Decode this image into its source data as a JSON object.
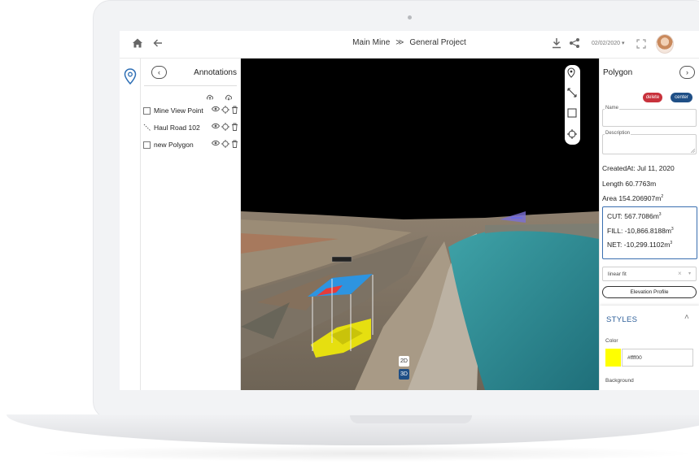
{
  "header": {
    "project": "Main Mine",
    "separator": "≫",
    "subproject": "General Project",
    "date": "02/02/2020",
    "date_caret": "▾",
    "icons": [
      "home-icon",
      "back-arrow-icon",
      "download-icon",
      "share-icon",
      "fullscreen-icon"
    ]
  },
  "annotations": {
    "title": "Annotations",
    "back_glyph": "‹",
    "items": [
      {
        "label": "Mine View Point",
        "type": "point"
      },
      {
        "label": "Haul Road 102",
        "type": "line"
      },
      {
        "label": "new Polygon",
        "type": "polygon"
      }
    ]
  },
  "viewport": {
    "mode_2d": "2D",
    "mode_3d": "3D",
    "active_mode": "3D",
    "tools": [
      "location-pin-icon",
      "measure-line-icon",
      "rectangle-icon",
      "crosshair-icon"
    ]
  },
  "details": {
    "title": "Polygon",
    "next_glyph": "›",
    "delete_label": "delete",
    "center_label": "center",
    "name_label": "Name",
    "name_value": "",
    "description_label": "Description",
    "description_value": "",
    "created_at": "CreatedAt: Jul 11, 2020",
    "length": "Length 60.7763m",
    "area": "Area 154.206907m",
    "area_unit_sup": "2",
    "volume": {
      "cut": "CUT: 567.7086m",
      "fill": "FILL: -10,866.8188m",
      "net": "NET: -10,299.1102m",
      "unit_sup": "3"
    },
    "fit_method": "linear fit",
    "clear_glyph": "×",
    "dropdown_glyph": "▾",
    "elevation_button": "Elevation Profile"
  },
  "styles": {
    "title": "STYLES",
    "collapse_glyph": "˄",
    "color_label": "Color",
    "color_value": "#ffff00",
    "background_label": "Background"
  },
  "colors": {
    "accent_blue": "#2e5f99",
    "delete_red": "#c8323c",
    "center_navy": "#1f4f86",
    "polygon_yellow": "#ffff00"
  }
}
